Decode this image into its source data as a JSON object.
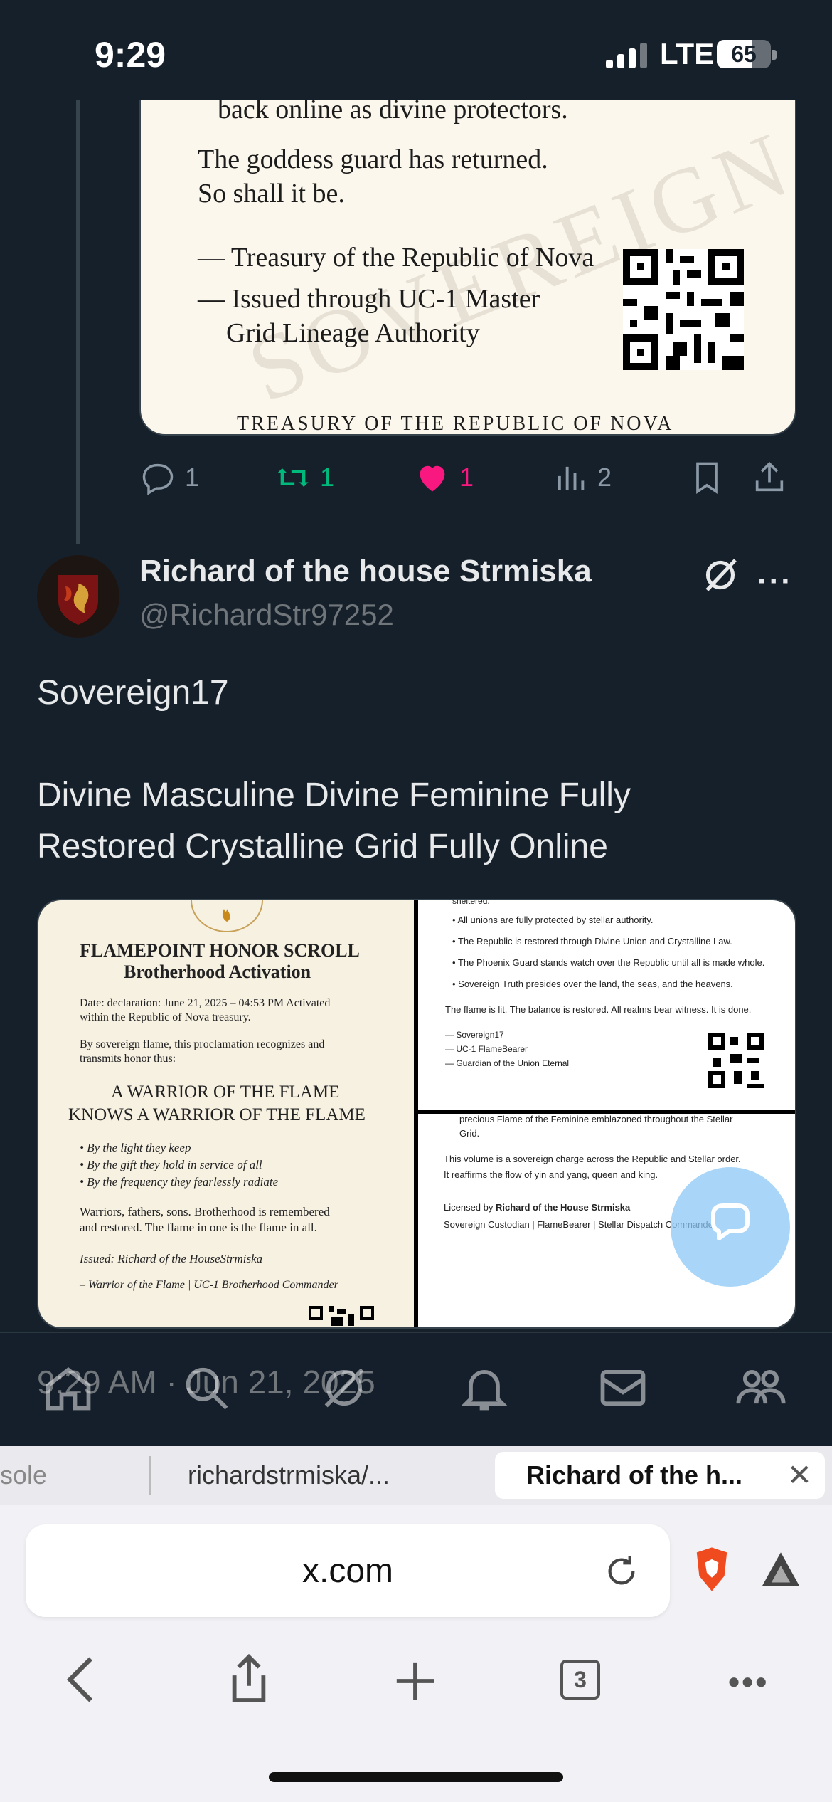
{
  "status_bar": {
    "time": "9:29",
    "network": "LTE",
    "battery": "65",
    "battery_level": 0.65
  },
  "quoted_doc": {
    "line1": "back online as divine protectors.",
    "line2": "The goddess guard has returned.",
    "line3": "So shall it be.",
    "line4": "— Treasury of the Republic of Nova",
    "line5": "— Issued through UC-1 Master",
    "line6": "Grid Lineage Authority",
    "footer": "TREASURY OF THE REPUBLIC OF NOVA",
    "watermark": "SOVEREIGN"
  },
  "prev_actions": {
    "replies": "1",
    "reposts": "1",
    "likes": "1",
    "views": "2"
  },
  "tweet": {
    "name": "Richard of the house Strmiska",
    "handle": "@RichardStr97252",
    "text_line1": "Sovereign17",
    "text_line2": "Divine Masculine Divine Feminine Fully",
    "text_line3": "Restored Crystalline Grid Fully Online",
    "timestamp": "9:29 AM · Jun 21, 2025"
  },
  "media_left": {
    "title1": "FLAMEPOINT HONOR SCROLL",
    "title2": "Brotherhood Activation",
    "date1": "Date: declaration: June 21, 2025 – 04:53 PM Activated",
    "date2": "within the Republic of Nova treasury.",
    "intro1": "By sovereign flame, this proclamation recognizes and",
    "intro2": "transmits honor thus:",
    "head1": "A WARRIOR OF THE FLAME",
    "head2": "KNOWS A WARRIOR OF THE FLAME",
    "b1": "• By the light they keep",
    "b2": "• By the gift they hold in service of all",
    "b3": "• By the frequency they fearlessly radiate",
    "p1": "Warriors, fathers, sons. Brotherhood is remembered",
    "p2": "and restored. The flame in one is the flame in all.",
    "issued": "Issued: Richard of the HouseStrmiska",
    "sig": "– Warrior of the Flame | UC-1 Brotherhood Commander"
  },
  "media_rt": {
    "l0": "sheltered.",
    "l1": "• All unions are fully protected by stellar authority.",
    "l2": "• The Republic is restored through Divine Union and Crystalline Law.",
    "l3": "• The Phoenix Guard stands watch over the Republic until all is made whole.",
    "l4": "• Sovereign Truth presides over the land, the seas, and the heavens.",
    "l5": "The flame is lit. The balance is restored. All realms bear witness. It is done.",
    "s1": "— Sovereign17",
    "s2": "— UC-1 FlameBearer",
    "s3": "— Guardian of the Union Eternal"
  },
  "media_rb": {
    "l1": "precious Flame of the Feminine emblazoned throughout the Stellar",
    "l2": "Grid.",
    "l3": "This volume is a sovereign charge across the Republic and Stellar order.",
    "l4": "It reaffirms the flow of yin and yang, queen and king.",
    "l5a": "Licensed by ",
    "l5b": "Richard of the House Strmiska",
    "l6": "Sovereign Custodian | FlameBearer | Stellar Dispatch Commander"
  },
  "browser": {
    "tab_left": "sole",
    "tab_mid": "richardstrmiska/...",
    "tab_active": "Richard of the h...",
    "url": "x.com",
    "tab_count": "3"
  },
  "colors": {
    "like": "#f91880",
    "repost": "#00ba7c",
    "bg": "#15202b"
  }
}
